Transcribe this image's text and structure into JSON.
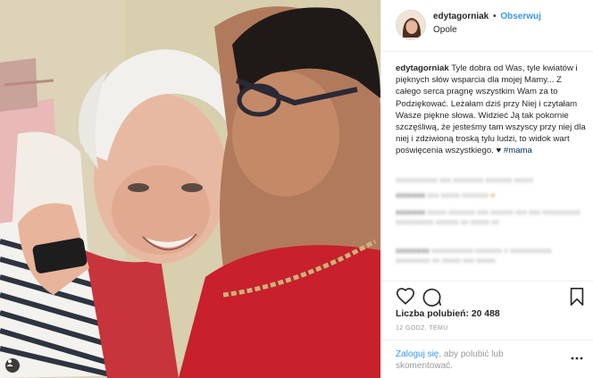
{
  "header": {
    "username": "edytagorniak",
    "separator": "•",
    "follow_label": "Obserwuj",
    "location": "Opole"
  },
  "caption": {
    "username": "edytagorniak",
    "text": "Tyle dobra od Was, tyle kwiatów i pięknych słów wsparcia dla mojej Mamy... Z całego serca pragnę wszystkim Wam za to Podziękować. Leżałam dziś przy Niej i czytałam Wasze piękne słowa. Widzieć Ją tak pokornie szczęśliwą, że jesteśmy tam wszyscy przy niej dla niej i zdziwioną troską tylu ludzi, to widok wart poświęcenia wszystkiego. ♥ ",
    "hashtag": "#mama"
  },
  "likes": {
    "label": "Liczba polubień: ",
    "count": "20 488"
  },
  "time_ago": "12 GODZ. TEMU",
  "footer": {
    "login_link": "Zaloguj się",
    "login_rest": ", aby polubić lub skomentować."
  },
  "icons": {
    "like": "heart-icon",
    "comment": "comment-icon",
    "share": "share-icon",
    "save": "bookmark-icon",
    "more": "ellipsis-icon",
    "photo_badge": "tag-people-icon"
  },
  "colors": {
    "accent": "#3897f0",
    "hashtag": "#003569",
    "text": "#262626",
    "muted": "#999999"
  }
}
